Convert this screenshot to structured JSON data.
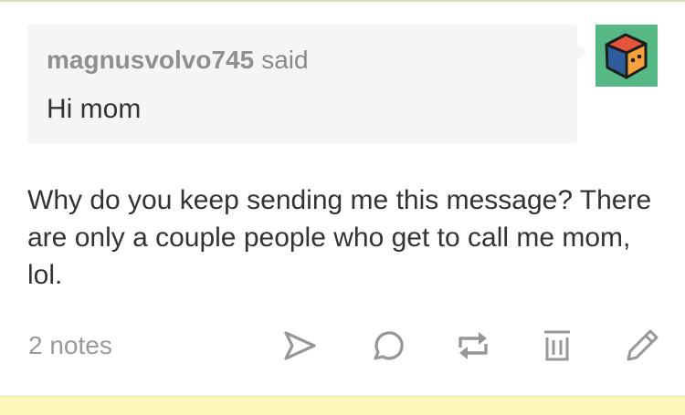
{
  "ask": {
    "asker": "magnusvolvo745",
    "said": "said",
    "message": "Hi mom"
  },
  "avatar": {
    "icon": "cube-avatar-icon",
    "background_color": "#56b985"
  },
  "answer": {
    "text": "Why do you keep sending me this message? There are only a couple people who get to call me mom, lol."
  },
  "footer": {
    "notes": "2 notes",
    "actions": [
      {
        "icon": "share-icon"
      },
      {
        "icon": "reply-icon"
      },
      {
        "icon": "reblog-icon"
      },
      {
        "icon": "delete-icon"
      },
      {
        "icon": "edit-icon"
      }
    ]
  },
  "colors": {
    "icon_gray": "#979797",
    "text": "#333333",
    "muted_text": "#8a8a8a",
    "ask_background": "#f5f5f5",
    "bottom_band": "#fcf6b8"
  }
}
